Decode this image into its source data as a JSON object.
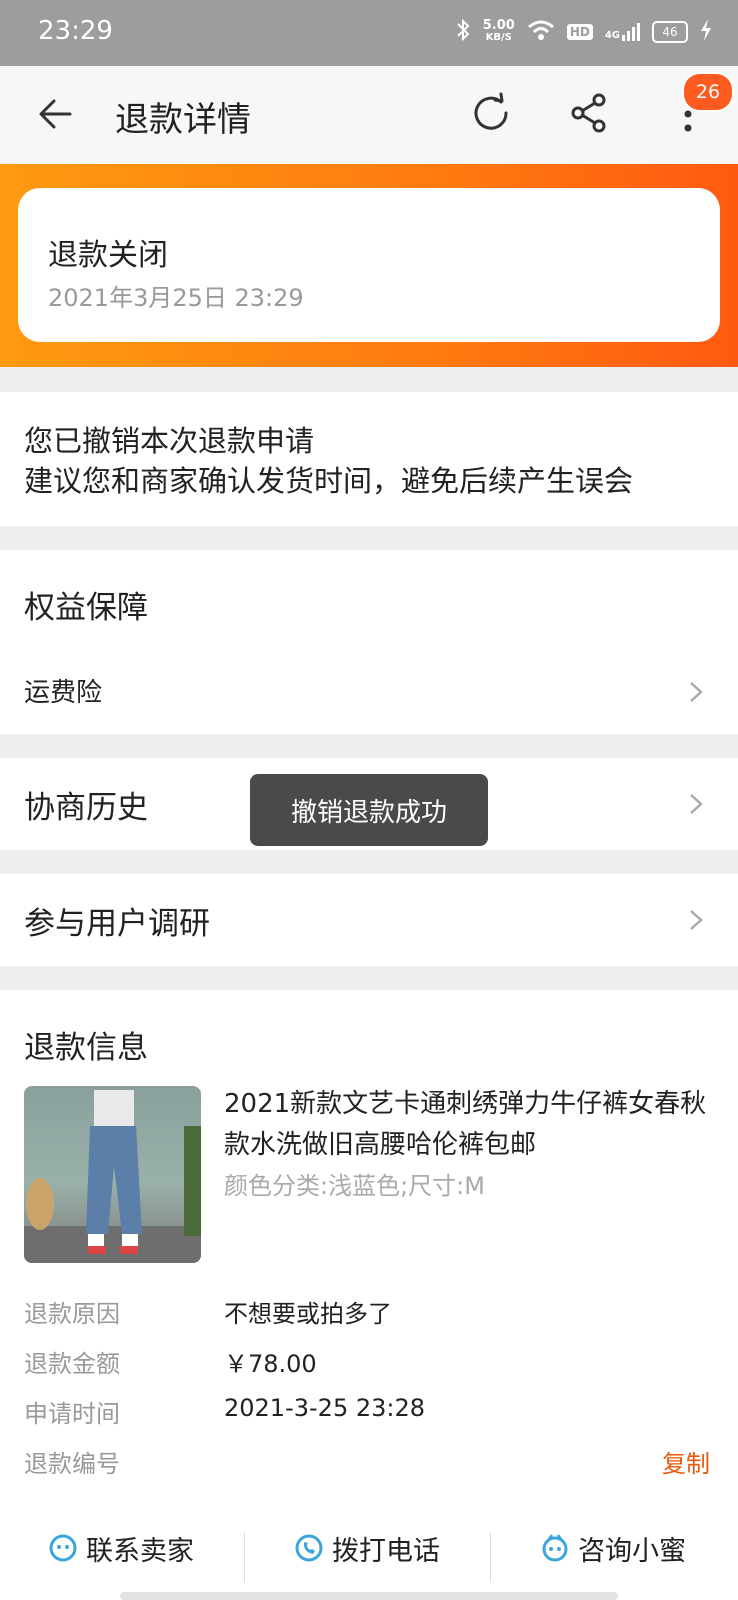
{
  "status_bar": {
    "time": "23:29",
    "net_speed_value": "5.00",
    "net_speed_unit": "KB/S",
    "hd": "HD",
    "signal": "4G",
    "battery": "46"
  },
  "nav": {
    "title": "退款详情",
    "badge_count": "26",
    "icons": [
      "back-arrow-icon",
      "refresh-icon",
      "share-icon",
      "more-vertical-icon"
    ]
  },
  "refund_status": {
    "title": "退款关闭",
    "time": "2021年3月25日 23:29"
  },
  "notice": {
    "line1": "您已撤销本次退款申请",
    "line2": "建议您和商家确认发货时间，避免后续产生误会"
  },
  "benefits": {
    "title": "权益保障",
    "item": "运费险"
  },
  "history": {
    "title": "协商历史"
  },
  "survey": {
    "title": "参与用户调研"
  },
  "toast": "撤销退款成功",
  "refund_info": {
    "title": "退款信息",
    "product": {
      "title": "2021新款文艺卡通刺绣弹力牛仔裤女春秋款水洗做旧高腰哈伦裤包邮",
      "spec": "颜色分类:浅蓝色;尺寸:M"
    },
    "rows": [
      {
        "label": "退款原因",
        "value": "不想要或拍多了"
      },
      {
        "label": "退款金额",
        "value": "￥78.00"
      },
      {
        "label": "申请时间",
        "value": "2021-3-25 23:28"
      },
      {
        "label": "退款编号",
        "value": ""
      }
    ],
    "copy_label": "复制"
  },
  "bottom_bar": {
    "contact_seller": "联系卖家",
    "call_phone": "拨打电话",
    "consult": "咨询小蜜"
  },
  "colors": {
    "accent": "#ff6a00",
    "badge": "#ff5a1f",
    "link": "#e8590c",
    "icon_blue": "#3ba6d9"
  }
}
